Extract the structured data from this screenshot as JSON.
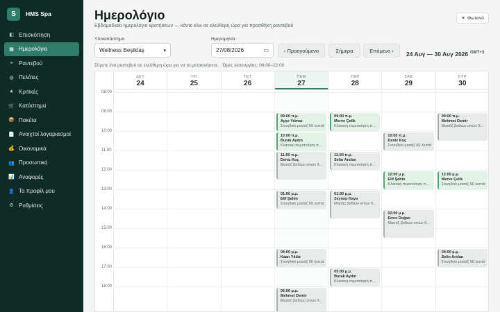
{
  "brand": {
    "logo_letter": "S",
    "name": "HMS Spa"
  },
  "sidebar": {
    "items": [
      {
        "label": "Επισκόπηση",
        "icon": "dashboard-icon",
        "glyph": "◧",
        "active": false
      },
      {
        "label": "Ημερολόγιο",
        "icon": "calendar-icon",
        "glyph": "▦",
        "active": true
      },
      {
        "label": "Ραντεβού",
        "icon": "list-icon",
        "glyph": "≡",
        "active": false
      },
      {
        "label": "Πελάτες",
        "icon": "clients-icon",
        "glyph": "◍",
        "active": false
      },
      {
        "label": "Κριτικές",
        "icon": "star-icon",
        "glyph": "★",
        "active": false
      },
      {
        "label": "Κατάστημα",
        "icon": "cart-icon",
        "glyph": "🛒",
        "active": false
      },
      {
        "label": "Πακέτα",
        "icon": "package-icon",
        "glyph": "📦",
        "active": false
      },
      {
        "label": "Ανοιχτοί λογαριασμοί",
        "icon": "receipt-icon",
        "glyph": "📄",
        "active": false
      },
      {
        "label": "Οικονομικά",
        "icon": "money-icon",
        "glyph": "💰",
        "active": false
      },
      {
        "label": "Προσωπικό",
        "icon": "staff-icon",
        "glyph": "👥",
        "active": false
      },
      {
        "label": "Αναφορές",
        "icon": "chart-icon",
        "glyph": "📊",
        "active": false
      },
      {
        "label": "Το προφίλ μου",
        "icon": "user-icon",
        "glyph": "👤",
        "active": false
      },
      {
        "label": "Ρυθμίσεις",
        "icon": "gear-icon",
        "glyph": "⚙",
        "active": false
      }
    ]
  },
  "header": {
    "title": "Ημερολόγιο",
    "subtitle": "Εβδομαδιαίο ημερολόγιο κρατήσεων — κάντε κλικ σε ελεύθερη ώρα για προσθήκη ραντεβού",
    "theme_button": "Φωτεινό",
    "theme_icon": "☀"
  },
  "toolbar": {
    "branch_label": "Υποκατάστημα",
    "branch_value": "Wellness Beşiktaş",
    "date_label": "Ημερομηνία",
    "date_value": "27/08/2026",
    "prev_label": "‹ Προηγούμενο",
    "today_label": "Σήμερα",
    "next_label": "Επόμενο ›",
    "range": "24 Αυγ — 30 Αυγ 2026",
    "timezone": "GMT+3"
  },
  "hint": "Σύρετε ένα ραντεβού σε ελεύθερη ώρα για να το μετακινήσετε. · Ώρες λειτουργίας: 08:00–22:00",
  "calendar": {
    "hours": [
      "08:00",
      "09:00",
      "10:00",
      "11:00",
      "12:00",
      "13:00",
      "14:00",
      "15:00",
      "16:00",
      "17:00",
      "18:00"
    ],
    "days": [
      {
        "name": "ΔΕΥ",
        "num": "24",
        "today": false
      },
      {
        "name": "ΤΡΙ",
        "num": "25",
        "today": false
      },
      {
        "name": "ΤΕΤ",
        "num": "26",
        "today": false
      },
      {
        "name": "ΠΕΜ",
        "num": "27",
        "today": true
      },
      {
        "name": "ΠΑΡ",
        "num": "28",
        "today": false
      },
      {
        "name": "ΣΑΒ",
        "num": "29",
        "today": false
      },
      {
        "name": "ΚΥΡ",
        "num": "30",
        "today": false
      }
    ],
    "events": [
      {
        "day": 3,
        "start": 9,
        "dur": 1,
        "color": "green",
        "time": "09:00 π.μ.",
        "client": "Ayşe Yılmaz",
        "service": "Σουηδικό μασάζ 60 λεπτά"
      },
      {
        "day": 3,
        "start": 10,
        "dur": 1,
        "color": "green",
        "time": "10:00 π.μ.",
        "client": "Burak Aydın",
        "service": "Κλασική περιποίηση προσώπου"
      },
      {
        "day": 3,
        "start": 11,
        "dur": 1.5,
        "color": "grey",
        "time": "11:00 π.μ.",
        "client": "Deniz Koç",
        "service": "Μασάζ βαθιών ιστών 90 λεπτά"
      },
      {
        "day": 3,
        "start": 13,
        "dur": 1,
        "color": "grey",
        "time": "01:00 μ.μ.",
        "client": "Elif Şahin",
        "service": "Σουηδικό μασάζ 60 λεπτά"
      },
      {
        "day": 3,
        "start": 16,
        "dur": 1,
        "color": "grey",
        "time": "04:00 μ.μ.",
        "client": "Kaan Yıldız",
        "service": "Σουηδικό μασάζ 60 λεπτά"
      },
      {
        "day": 3,
        "start": 18,
        "dur": 1.5,
        "color": "grey",
        "time": "06:00 μ.μ.",
        "client": "Mehmet Demir",
        "service": "Μασάζ βαθιών ιστών 90 λεπτά"
      },
      {
        "day": 4,
        "start": 9,
        "dur": 1,
        "color": "green",
        "time": "09:00 π.μ.",
        "client": "Merve Çelik",
        "service": "Κλασική περιποίηση προσώπου"
      },
      {
        "day": 4,
        "start": 11,
        "dur": 1,
        "color": "grey",
        "time": "11:00 π.μ.",
        "client": "Selin Arslan",
        "service": "Κλασική περιποίηση προσώπου"
      },
      {
        "day": 4,
        "start": 13,
        "dur": 1.5,
        "color": "grey",
        "time": "01:00 μ.μ.",
        "client": "Zeynep Kaya",
        "service": "Μασάζ βαθιών ιστών 90 λεπτά"
      },
      {
        "day": 4,
        "start": 17,
        "dur": 1,
        "color": "grey",
        "time": "05:00 μ.μ.",
        "client": "Burak Aydın",
        "service": "Κλασική περιποίηση προσώπου"
      },
      {
        "day": 5,
        "start": 10,
        "dur": 1,
        "color": "grey",
        "time": "10:00 π.μ.",
        "client": "Deniz Koç",
        "service": "Σουηδικό μασάζ 60 λεπτά"
      },
      {
        "day": 5,
        "start": 12,
        "dur": 1,
        "color": "green",
        "time": "12:00 μ.μ.",
        "client": "Elif Şahin",
        "service": "Κλασική περιποίηση προσώπου"
      },
      {
        "day": 5,
        "start": 14,
        "dur": 1.5,
        "color": "grey",
        "time": "02:00 μ.μ.",
        "client": "Emre Doğan",
        "service": "Μασάζ βαθιών ιστών 90 λεπτά"
      },
      {
        "day": 6,
        "start": 9,
        "dur": 1.5,
        "color": "grey",
        "time": "09:00 π.μ.",
        "client": "Mehmet Demir",
        "service": "Μασάζ βαθιών ιστών 90 λεπτά"
      },
      {
        "day": 6,
        "start": 12,
        "dur": 1,
        "color": "green",
        "time": "12:00 μ.μ.",
        "client": "Merve Çelik",
        "service": "Σουηδικό μασάζ 60 λεπτά"
      },
      {
        "day": 6,
        "start": 16,
        "dur": 1,
        "color": "grey",
        "time": "04:00 μ.μ.",
        "client": "Selin Arslan",
        "service": "Σουηδικό μασάζ 60 λεπτά"
      }
    ]
  }
}
